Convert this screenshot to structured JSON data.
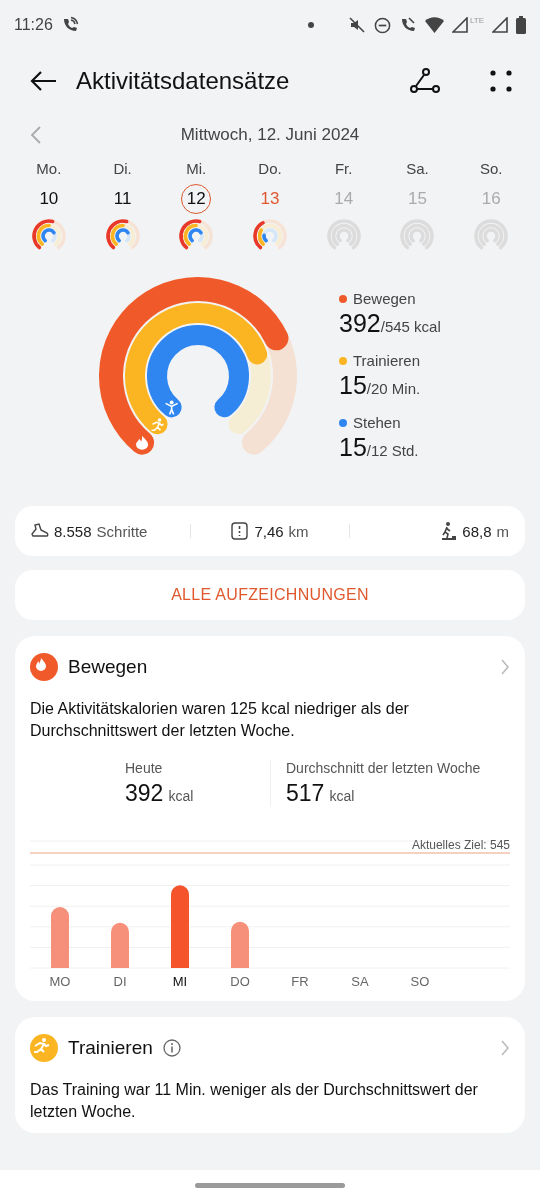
{
  "status_bar": {
    "time": "11:26",
    "network": "LTE"
  },
  "header": {
    "title": "Aktivitätsdatensätze",
    "date": "Mittwoch, 12. Juni 2024"
  },
  "week": [
    {
      "label": "Mo.",
      "day": "10",
      "kind": "active",
      "selected": false
    },
    {
      "label": "Di.",
      "day": "11",
      "kind": "active",
      "selected": false
    },
    {
      "label": "Mi.",
      "day": "12",
      "kind": "active",
      "selected": true
    },
    {
      "label": "Do.",
      "day": "13",
      "kind": "today",
      "selected": false
    },
    {
      "label": "Fr.",
      "day": "14",
      "kind": "future",
      "selected": false
    },
    {
      "label": "Sa.",
      "day": "15",
      "kind": "future",
      "selected": false
    },
    {
      "label": "So.",
      "day": "16",
      "kind": "future",
      "selected": false
    }
  ],
  "rings": [
    {
      "name": "Bewegen",
      "value": "392",
      "target": "/545 kcal",
      "color": "#f05a2a"
    },
    {
      "name": "Trainieren",
      "value": "15",
      "target": "/20 Min.",
      "color": "#fbb522"
    },
    {
      "name": "Stehen",
      "value": "15",
      "target": "/12 Std.",
      "color": "#2f86f0"
    }
  ],
  "stats": [
    {
      "kind": "steps",
      "value": "8.558",
      "unit": "Schritte"
    },
    {
      "kind": "distance",
      "value": "7,46",
      "unit": "km"
    },
    {
      "kind": "climb",
      "value": "68,8",
      "unit": "m"
    }
  ],
  "records_button": "ALLE AUFZEICHNUNGEN",
  "cards": [
    {
      "kind": "move",
      "title": "Bewegen",
      "info": false,
      "text": "Die Aktivitätskalorien waren 125 kcal niedriger als der Durchschnittswert der letzten Woche.",
      "today": {
        "label": "Heute",
        "value": "392",
        "unit": "kcal"
      },
      "average": {
        "label": "Durchschnitt der letzten Woche",
        "value": "517",
        "unit": "kcal"
      },
      "bars": [
        {
          "selected": false
        },
        {
          "selected": false
        },
        {
          "selected": true
        },
        {
          "selected": false
        },
        {
          "selected": false
        },
        {
          "selected": false
        },
        {
          "selected": false
        }
      ],
      "chart_data": {
        "type": "bar",
        "categories": [
          "MO",
          "DI",
          "MI",
          "DO",
          "FR",
          "SA",
          "SO"
        ],
        "values": [
          289,
          214,
          392,
          219,
          null,
          null,
          null
        ],
        "ylim": [
          0,
          545
        ],
        "yticks": [
          {
            "value": 545,
            "label": "Aktuelles Ziel: 545"
          }
        ]
      }
    },
    {
      "kind": "exercise",
      "title": "Trainieren",
      "info": true,
      "text": "Das Training war 11 Min. weniger als der Durchschnittswert der letzten Woche."
    }
  ]
}
